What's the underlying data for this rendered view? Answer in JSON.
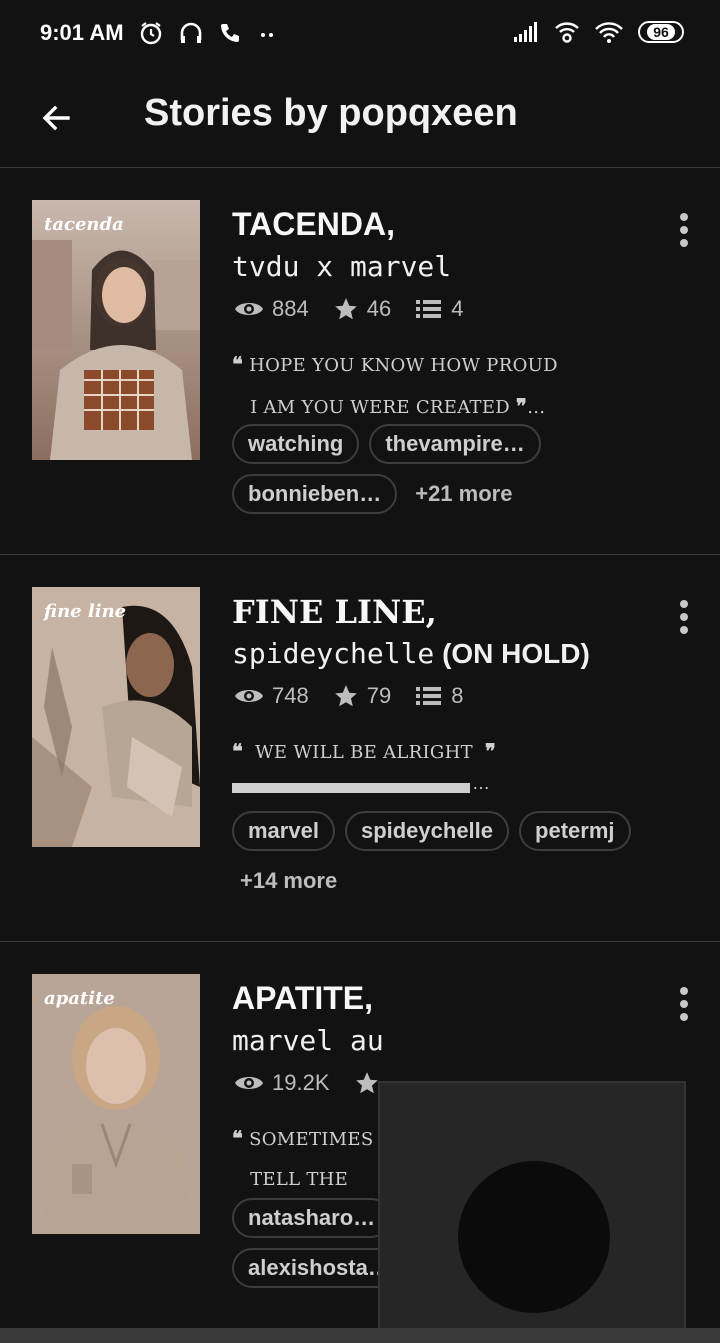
{
  "status_bar": {
    "time": "9:01 AM",
    "battery": "96"
  },
  "header": {
    "title": "Stories by popqxeen"
  },
  "stories": [
    {
      "cover_text": "tacenda",
      "title": "TACENDA,",
      "subtitle_mono": "tvdu x marvel",
      "subtitle_extra": "",
      "views": "884",
      "votes": "46",
      "parts": "4",
      "desc_line1": "HOPE YOU KNOW HOW PROUD",
      "desc_line2": "I AM YOU WERE CREATED",
      "tags": [
        "watching",
        "thevampire…",
        "bonnieben…"
      ],
      "more_tags": "+21 more"
    },
    {
      "cover_text": "fine line",
      "title": "FINE LINE,",
      "subtitle_mono": "spideychelle",
      "subtitle_extra": "(ON HOLD)",
      "views": "748",
      "votes": "79",
      "parts": "8",
      "desc_line1": "WE WILL BE ALRIGHT",
      "desc_line2": "",
      "tags": [
        "marvel",
        "spideychelle",
        "petermj"
      ],
      "more_tags": "+14 more"
    },
    {
      "cover_text": "apatite",
      "title": "APATITE,",
      "subtitle_mono": "marvel au",
      "subtitle_extra": "",
      "views": "19.2K",
      "votes": "",
      "parts": "",
      "desc_line1": "SOMETIMES",
      "desc_line2": "TELL THE",
      "tags": [
        "natasharo…",
        "alexishosta…"
      ],
      "more_tags": ""
    }
  ],
  "colors": {
    "background": "#121212",
    "divider": "#3a3a3a",
    "tag_border": "#3d3d3d"
  },
  "icons": [
    "alarm-icon",
    "headphones-icon",
    "phone-icon",
    "signal-icon",
    "wifi-icon",
    "back-arrow-icon",
    "eye-icon",
    "star-icon",
    "list-icon",
    "more-vert-icon"
  ]
}
